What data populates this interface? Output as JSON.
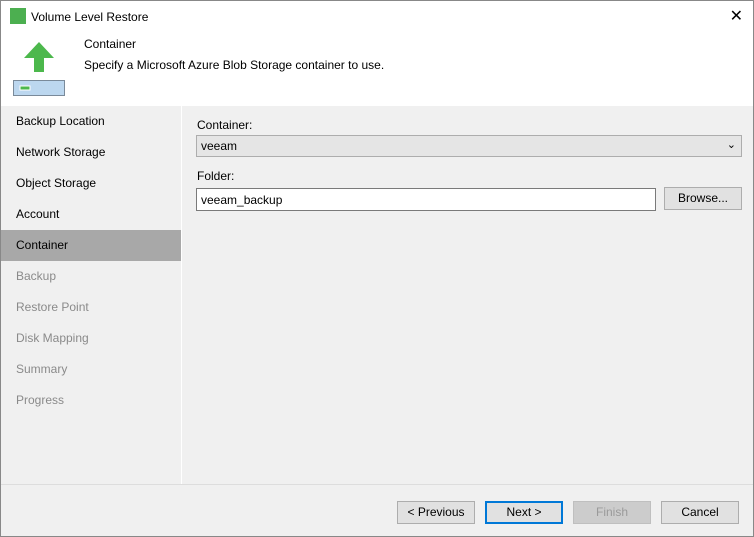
{
  "window": {
    "title": "Volume Level Restore"
  },
  "header": {
    "title": "Container",
    "description": "Specify a Microsoft Azure Blob Storage container to use."
  },
  "sidebar": {
    "items": [
      {
        "label": "Backup Location",
        "state": "done"
      },
      {
        "label": "Network Storage",
        "state": "done"
      },
      {
        "label": "Object Storage",
        "state": "done"
      },
      {
        "label": "Account",
        "state": "done"
      },
      {
        "label": "Container",
        "state": "active"
      },
      {
        "label": "Backup",
        "state": "pending"
      },
      {
        "label": "Restore Point",
        "state": "pending"
      },
      {
        "label": "Disk Mapping",
        "state": "pending"
      },
      {
        "label": "Summary",
        "state": "pending"
      },
      {
        "label": "Progress",
        "state": "pending"
      }
    ]
  },
  "form": {
    "container_label": "Container:",
    "container_value": "veeam",
    "folder_label": "Folder:",
    "folder_value": "veeam_backup",
    "browse_label": "Browse..."
  },
  "footer": {
    "previous": "< Previous",
    "next": "Next >",
    "finish": "Finish",
    "cancel": "Cancel"
  }
}
